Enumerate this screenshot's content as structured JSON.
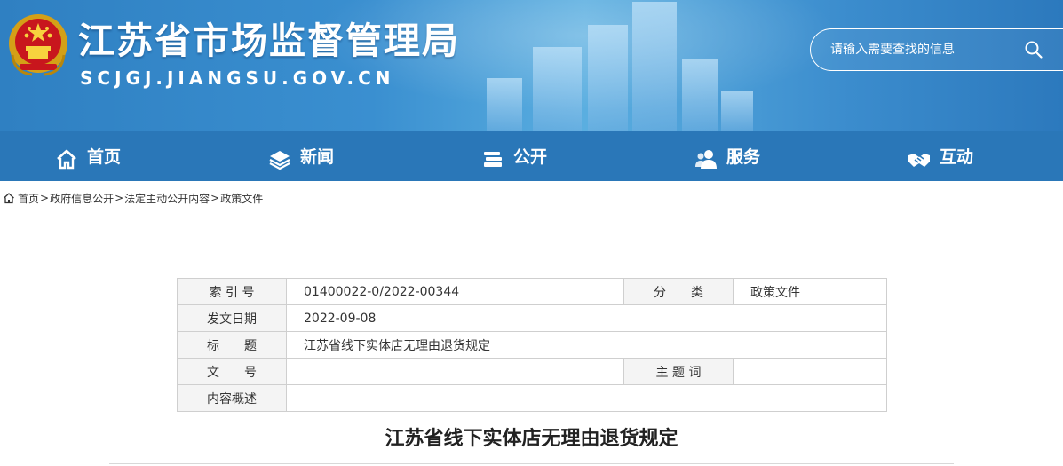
{
  "header": {
    "title": "江苏省市场监督管理局",
    "domain": "SCJGJ.JIANGSU.GOV.CN",
    "search_placeholder": "请输入需要查找的信息",
    "emblem_icon": "national-emblem-icon",
    "search_icon": "search-icon"
  },
  "nav": {
    "items": [
      {
        "label": "首页",
        "icon": "home-icon"
      },
      {
        "label": "新闻",
        "icon": "layers-icon"
      },
      {
        "label": "公开",
        "icon": "books-icon"
      },
      {
        "label": "服务",
        "icon": "users-icon"
      },
      {
        "label": "互动",
        "icon": "handshake-icon"
      }
    ]
  },
  "breadcrumb": {
    "items": [
      "首页",
      "政府信息公开",
      "法定主动公开内容",
      "政策文件"
    ],
    "separator": ">"
  },
  "info_table": {
    "index_label": "索 引 号",
    "index_value": "01400022-0/2022-00344",
    "category_label": "分　　类",
    "category_value": "政策文件",
    "date_label": "发文日期",
    "date_value": "2022-09-08",
    "title_label": "标　　题",
    "title_value": "江苏省线下实体店无理由退货规定",
    "docno_label": "文　　号",
    "docno_value": "",
    "subject_label": "主 题 词",
    "subject_value": "",
    "summary_label": "内容概述",
    "summary_value": ""
  },
  "article": {
    "title": "江苏省线下实体店无理由退货规定"
  },
  "colors": {
    "nav_bg": "#2a77b8",
    "banner_bg": "#3a8fd0",
    "table_label_bg": "#f4f4f4",
    "table_border": "#cfcfcf"
  }
}
